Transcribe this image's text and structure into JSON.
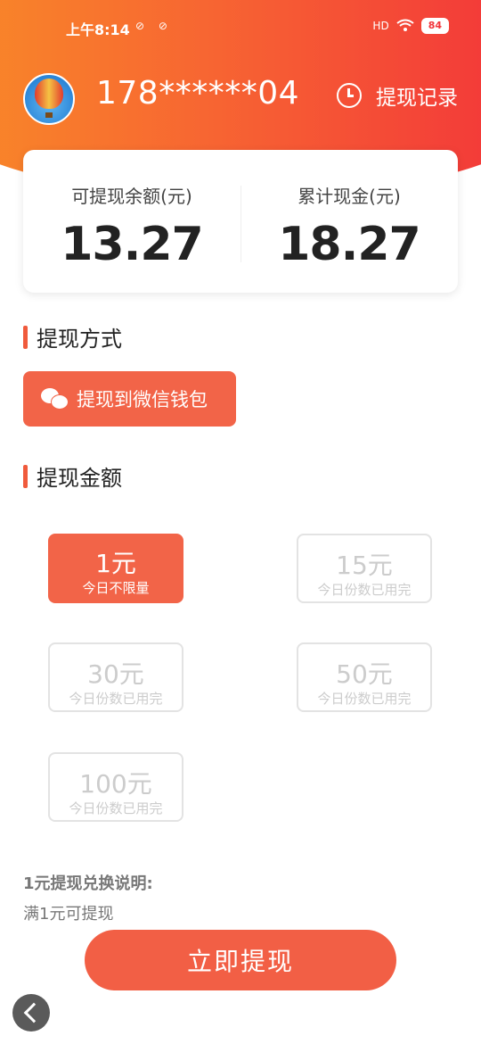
{
  "status_bar": {
    "time": "上午8:14",
    "left_icons": "⊘ ⊘",
    "network": "HD",
    "battery": "84"
  },
  "header": {
    "phone": "178******04",
    "history_label": "提现记录"
  },
  "balance": {
    "withdrawable_label": "可提现余额(元)",
    "withdrawable_value": "13.27",
    "total_label": "累计现金(元)",
    "total_value": "18.27"
  },
  "method": {
    "section_title": "提现方式",
    "option_label": "提现到微信钱包"
  },
  "amount": {
    "section_title": "提现金额",
    "options": [
      {
        "amount": "1元",
        "note": "今日不限量",
        "state": "active"
      },
      {
        "amount": "15元",
        "note": "今日份数已用完",
        "state": "disabled"
      },
      {
        "amount": "30元",
        "note": "今日份数已用完",
        "state": "disabled"
      },
      {
        "amount": "50元",
        "note": "今日份数已用完",
        "state": "disabled"
      },
      {
        "amount": "100元",
        "note": "今日份数已用完",
        "state": "disabled"
      }
    ]
  },
  "note": {
    "title": "1元提现兑换说明:",
    "body": "满1元可提现"
  },
  "submit_label": "立即提现",
  "colors": {
    "accent": "#f26448",
    "header_start": "#f98a28",
    "header_end": "#f2343a"
  }
}
